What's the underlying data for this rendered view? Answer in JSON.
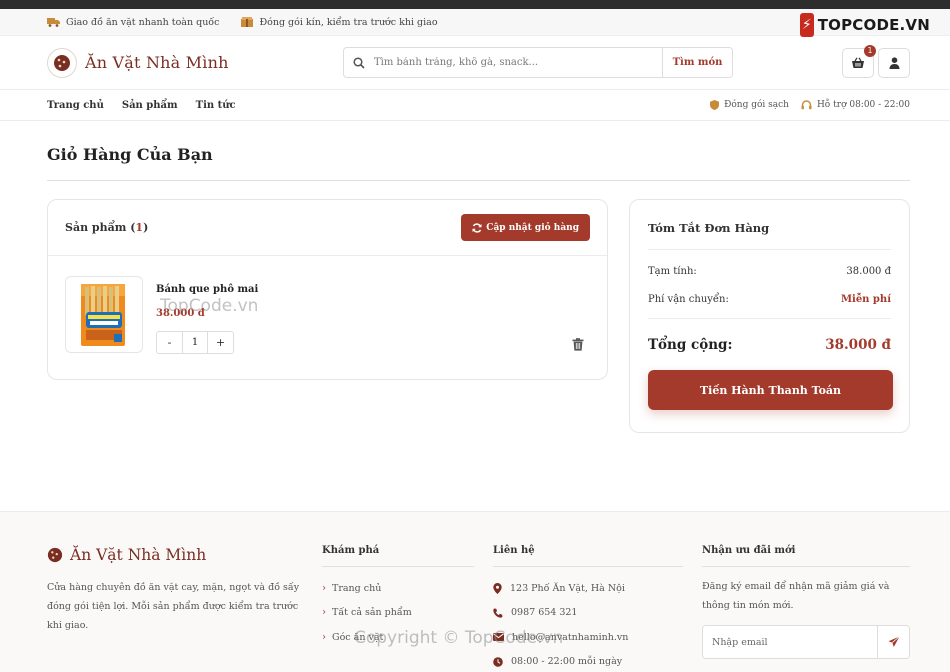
{
  "topbar": {
    "shipping_text": "Giao đồ ăn vặt nhanh toàn quốc",
    "packaging_text": "Đóng gói kín, kiểm tra trước khi giao"
  },
  "watermark_logo": {
    "text": "TOPCODE.VN"
  },
  "header": {
    "brand_name": "Ăn Vặt Nhà Mình",
    "search_placeholder": "Tìm bánh tráng, khô gà, snack...",
    "search_button": "Tìm món",
    "cart_count": "1"
  },
  "nav": {
    "items": [
      "Trang chủ",
      "Sản phẩm",
      "Tin tức"
    ],
    "clean_packaging": "Đóng gói sạch",
    "support": "Hỗ trợ 08:00 - 22:00"
  },
  "page": {
    "title": "Giỏ Hàng Của Bạn"
  },
  "cart": {
    "label": "Sản phẩm",
    "count": "1",
    "update_button": "Cập nhật giỏ hàng",
    "item": {
      "name": "Bánh que phô mai",
      "price": "38.000 đ",
      "quantity": "1",
      "minus": "-",
      "plus": "+"
    }
  },
  "watermark": {
    "text": "TopCode.vn"
  },
  "summary": {
    "title": "Tóm Tắt Đơn Hàng",
    "subtotal_label": "Tạm tính:",
    "subtotal_value": "38.000 đ",
    "shipping_label": "Phí vận chuyển:",
    "shipping_value": "Miễn phí",
    "total_label": "Tổng cộng:",
    "total_value": "38.000 đ",
    "checkout_button": "Tiến Hành Thanh Toán"
  },
  "footer": {
    "brand_name": "Ăn Vặt Nhà Mình",
    "description": "Cửa hàng chuyên đồ ăn vặt cay, mặn, ngọt và đồ sấy đóng gói tiện lợi. Mỗi sản phẩm được kiểm tra trước khi giao.",
    "explore_title": "Khám phá",
    "explore_links": [
      "Trang chủ",
      "Tất cả sản phẩm",
      "Góc ăn vặt"
    ],
    "contact_title": "Liên hệ",
    "address": "123 Phố Ăn Vặt, Hà Nội",
    "phone": "0987 654 321",
    "email": "hello@anvatnhaminh.vn",
    "hours": "08:00 - 22:00 mỗi ngày",
    "newsletter_title": "Nhận ưu đãi mới",
    "newsletter_text": "Đăng ký email để nhận mã giảm giá và thông tin món mới.",
    "email_placeholder": "Nhập email"
  },
  "copyright": {
    "text": "Copyright © TopCode.vn"
  },
  "colors": {
    "accent": "#a33a2b",
    "brand": "#7a2e22"
  }
}
